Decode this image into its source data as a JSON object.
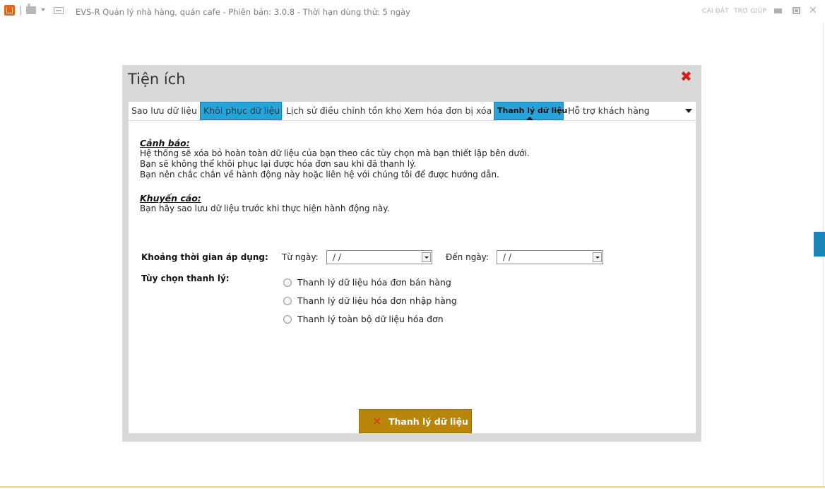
{
  "window": {
    "title": "EVS-R Quản lý nhà hàng, quán cafe - Phiên bản: 3.0.8 - Thời hạn dùng thử: 5 ngày",
    "settings_link": "CÀI ĐẶT",
    "help_link": "TRỢ GIÚP",
    "close_glyph": "✕"
  },
  "dialog": {
    "title": "Tiện ích",
    "close_glyph": "✖",
    "tabs": [
      {
        "label": "Sao lưu dữ liệu"
      },
      {
        "label": "Khôi phục dữ liệu"
      },
      {
        "label": "Lịch sử điều chỉnh tồn kho"
      },
      {
        "label": "Xem hóa đơn bị xóa"
      },
      {
        "label": "Thanh lý dữ liệu"
      },
      {
        "label": "Hỗ trợ khách hàng"
      }
    ],
    "active_tab": "Thanh lý dữ liệu"
  },
  "content": {
    "warning_title": "Cảnh báo:",
    "warning_lines": [
      "Hệ thống sẽ xóa bỏ hoàn toàn dữ liệu của bạn theo các tùy chọn mà bạn thiết lập bên dưới.",
      "Bạn sẽ không thể khôi phục lại được hóa đơn sau khi đã thanh lý.",
      "Bạn nên chắc chắn về hành động này hoặc liên hệ với chúng tôi để được hướng dẫn."
    ],
    "advice_title": "Khuyến cáo:",
    "advice_lines": [
      "Bạn hãy sao lưu dữ liệu trước khi thực hiện hành động này."
    ],
    "period_label": "Khoảng thời gian áp dụng:",
    "from_label": "Từ ngày:",
    "from_value": "/  /",
    "to_label": "Đến ngày:",
    "to_value": "/  /",
    "options_label": "Tùy chọn thanh lý:",
    "options": [
      "Thanh lý dữ liệu hóa đơn bán hàng",
      "Thanh lý dữ liệu hóa đơn nhập hàng",
      "Thanh lý toàn bộ dữ liệu hóa đơn"
    ],
    "submit_label": "Thanh lý dữ liệu",
    "submit_icon": "✕"
  },
  "colors": {
    "accent": "#27a3d8",
    "button": "#b8860b",
    "close": "#d11f1f"
  }
}
